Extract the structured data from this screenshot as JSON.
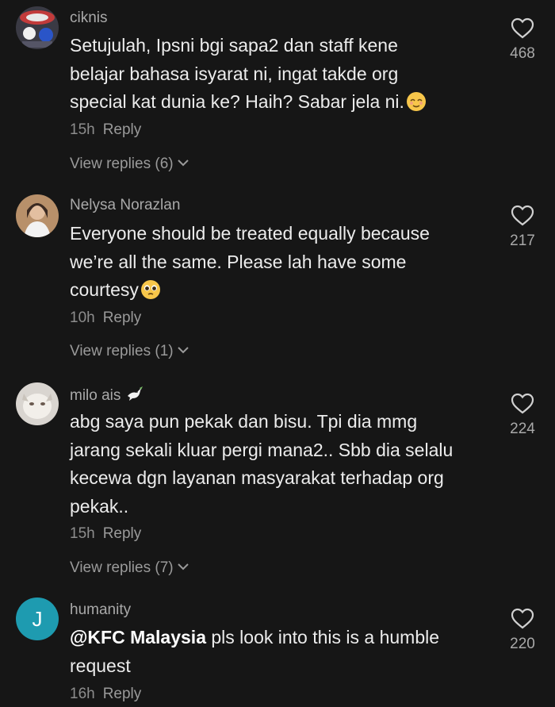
{
  "comments": [
    {
      "username": "ciknis",
      "text": "Setujulah, Ipsni bgi sapa2 dan staff kene\nbelajar bahasa isyarat ni, ingat takde org\nspecial kat dunia ke? Haih? Sabar jela ni.",
      "emoji": "relieved-face",
      "time": "15h",
      "reply": "Reply",
      "view_replies": "View replies (6)",
      "likes": "468"
    },
    {
      "username": "Nelysa Norazlan",
      "text": "Everyone should be treated equally because\nwe’re all the same. Please lah have some\ncourtesy",
      "emoji": "pleading-face",
      "time": "10h",
      "reply": "Reply",
      "view_replies": "View replies (1)",
      "likes": "217"
    },
    {
      "username": "milo ais",
      "flair": "dove",
      "text": "abg saya pun pekak dan bisu. Tpi dia mmg\njarang sekali kluar pergi mana2.. Sbb dia selalu\nkecewa dgn layanan masyarakat terhadap org\npekak..",
      "time": "15h",
      "reply": "Reply",
      "view_replies": "View replies (7)",
      "likes": "224"
    },
    {
      "username": "humanity",
      "avatar_letter": "J",
      "mention": "@KFC Malaysia",
      "text": " pls look into this is a humble\nrequest",
      "time": "16h",
      "reply": "Reply",
      "likes": "220"
    }
  ],
  "colors": {
    "background": "#161616",
    "text": "#ececec",
    "muted": "#8d8d8d",
    "avatar_letter_bg": "#1e9bb0"
  }
}
